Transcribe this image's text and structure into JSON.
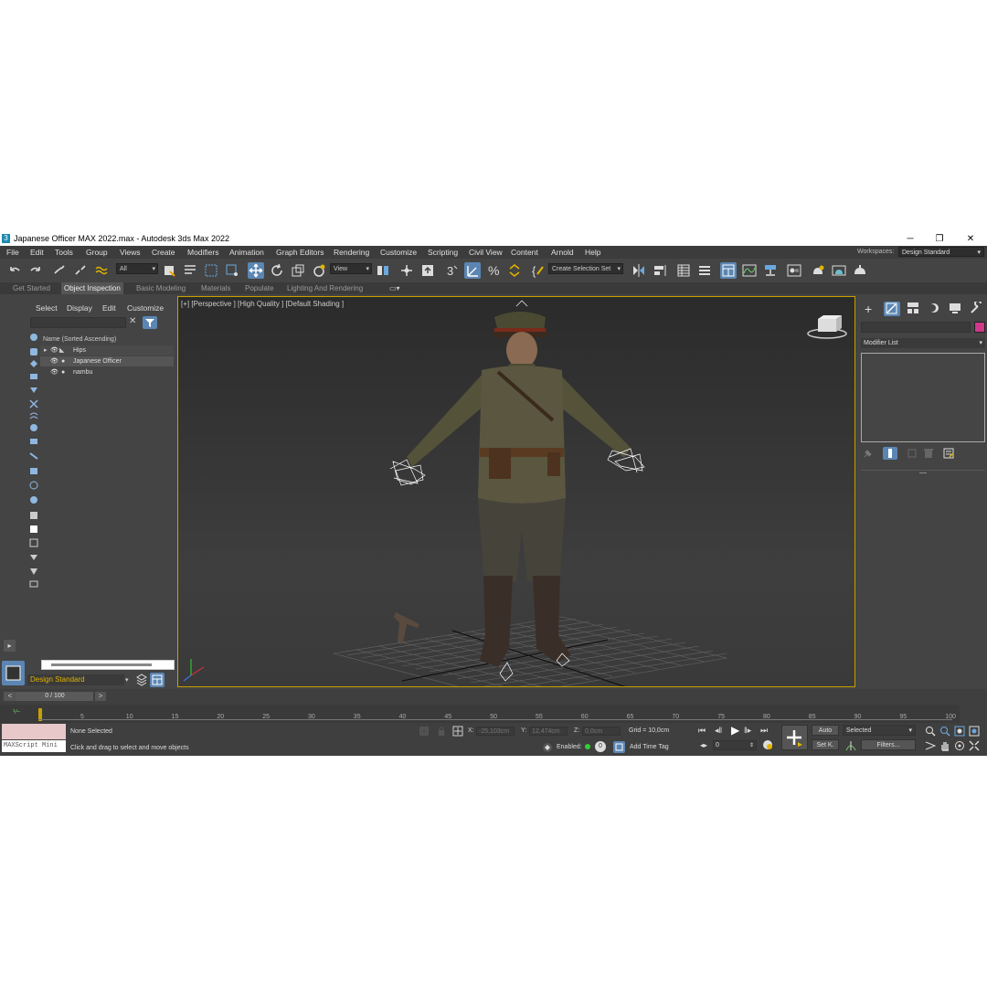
{
  "window": {
    "title": "Japanese Officer MAX 2022.max - Autodesk 3ds Max 2022",
    "app_icon": "3",
    "minimize": "─",
    "restore": "❐",
    "close": "✕"
  },
  "menu": [
    "File",
    "Edit",
    "Tools",
    "Group",
    "Views",
    "Create",
    "Modifiers",
    "Animation",
    "Graph Editors",
    "Rendering",
    "Customize",
    "Scripting",
    "Civil View",
    "Content",
    "Arnold",
    "Help"
  ],
  "workspace": {
    "label": "Workspaces:",
    "value": "Design Standard"
  },
  "toolbar": {
    "filter_select": "All",
    "reference_coord": "View",
    "selection_set": "Create Selection Set",
    "snap_label": "3"
  },
  "ribbon_tabs": [
    "Get Started",
    "Object Inspection",
    "Basic Modeling",
    "Materials",
    "Populate",
    "Lighting And Rendering"
  ],
  "scene_explorer": {
    "tabs": [
      "Select",
      "Display",
      "Edit",
      "Customize"
    ],
    "column_header": "Name (Sorted Ascending)",
    "items": [
      "Hips",
      "Japanese Officer",
      "nambu"
    ],
    "layer": "Design Standard"
  },
  "viewport": {
    "label": "[+] [Perspective ] [High Quality ] [Default Shading ]"
  },
  "command_panel": {
    "modifier_list": "Modifier List",
    "accent_color": "#d0388a"
  },
  "timeline": {
    "frame": "0 / 100",
    "ticks": [
      "5",
      "10",
      "15",
      "20",
      "25",
      "30",
      "35",
      "40",
      "45",
      "50",
      "55",
      "60",
      "65",
      "70",
      "75",
      "80",
      "85",
      "90",
      "95",
      "100"
    ]
  },
  "status": {
    "maxscript": "MAXScript Mini",
    "selection": "None Selected",
    "prompt": "Click and drag to select and move objects",
    "x_label": "X:",
    "x": "-25,103cm",
    "y_label": "Y:",
    "y": "12,474cm",
    "z_label": "Z:",
    "z": "0,0cm",
    "grid": "Grid = 10,0cm",
    "enabled": "Enabled:",
    "enabled_value": "0",
    "add_time_tag": "Add Time Tag",
    "auto": "Auto",
    "set_key": "Set K.",
    "selected": "Selected",
    "filters": "Filters...",
    "frame_field": "0"
  }
}
